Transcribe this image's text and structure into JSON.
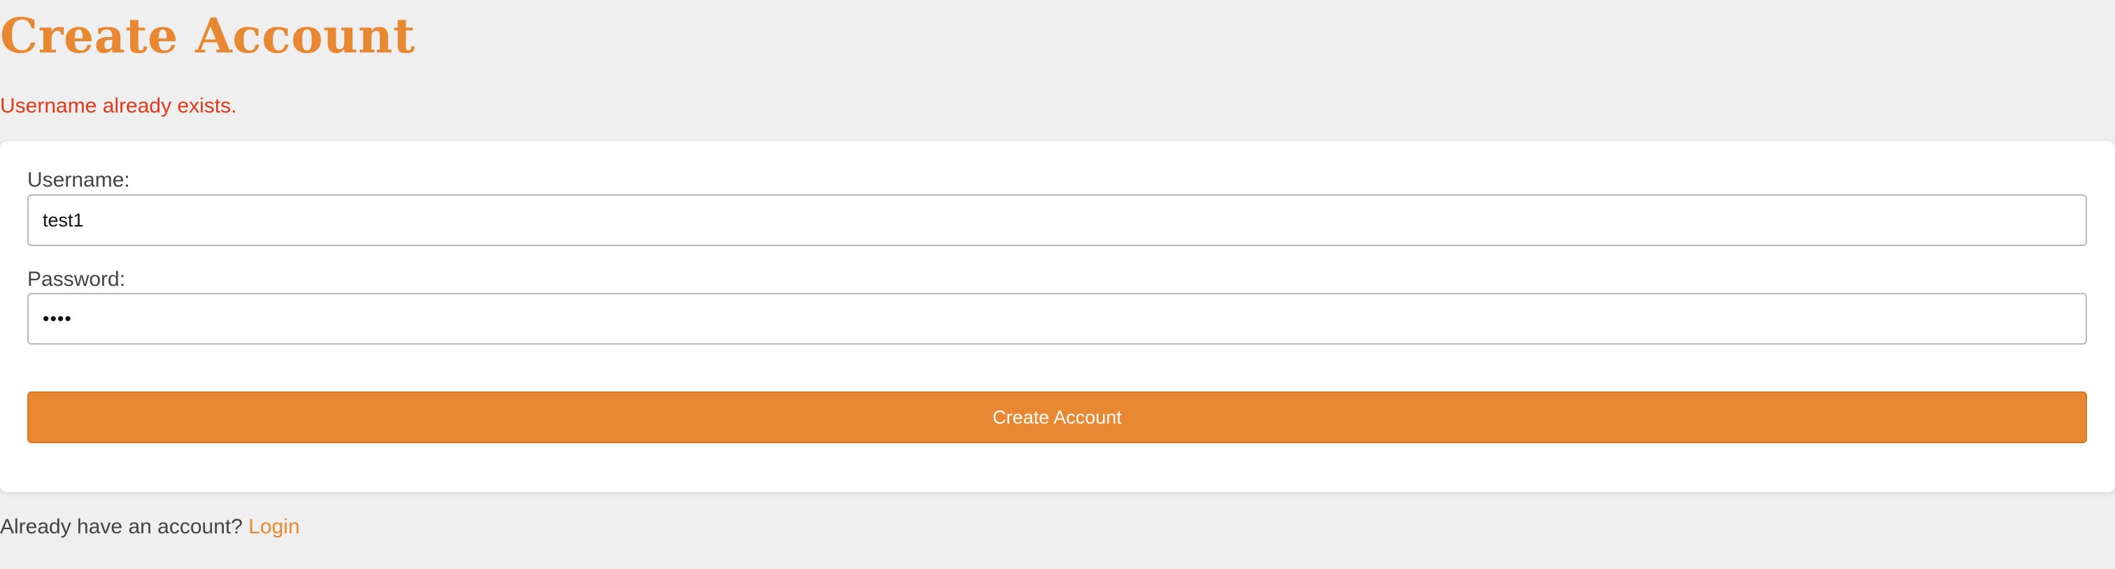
{
  "page": {
    "title": "Create Account",
    "error_message": "Username already exists."
  },
  "form": {
    "username_label": "Username:",
    "username_value": "test1",
    "password_label": "Password:",
    "password_value": "test",
    "submit_label": "Create Account"
  },
  "footer": {
    "prompt": "Already have an account?",
    "login_link": "Login"
  },
  "colors": {
    "background": "#efefef",
    "accent": "#e88832",
    "error": "#e23a1f",
    "text": "#444444",
    "card": "#ffffff"
  }
}
